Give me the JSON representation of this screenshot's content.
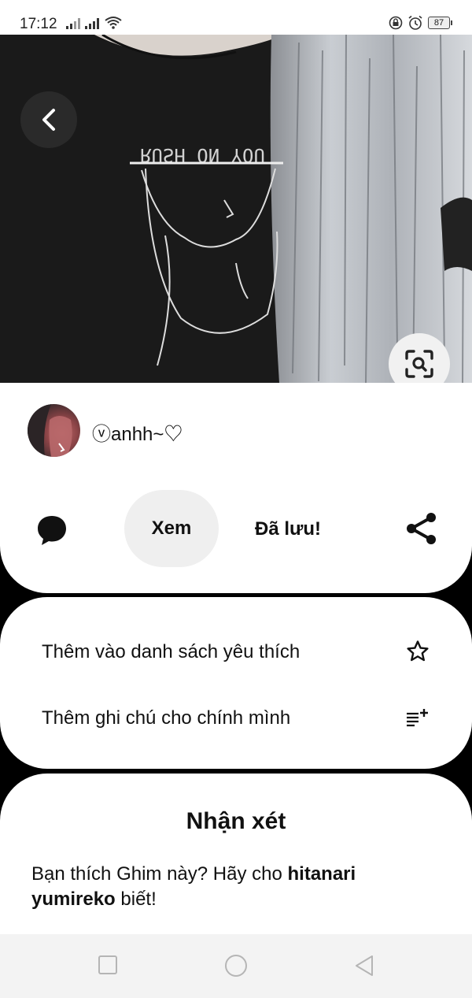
{
  "status_bar": {
    "time": "17:12",
    "battery": "87"
  },
  "hero": {
    "image_text": "RUSH ON YOU",
    "back_icon": "chevron-left-icon",
    "lens_icon": "visual-search-icon"
  },
  "pin": {
    "author_name": "ⓥanhh~♡",
    "actions": {
      "comment_icon": "speech-bubble-icon",
      "view_label": "Xem",
      "saved_label": "Đã lưu!",
      "share_icon": "share-icon"
    }
  },
  "options": {
    "favorite_label": "Thêm vào danh sách yêu thích",
    "note_label": "Thêm ghi chú cho chính mình"
  },
  "comments": {
    "title": "Nhận xét",
    "prompt_prefix": "Bạn thích Ghim này? Hãy cho ",
    "prompt_user": "hitanari yumireko",
    "prompt_suffix": " biết!"
  },
  "colors": {
    "background": "#000000",
    "card": "#ffffff",
    "button_gray": "#efefef"
  }
}
